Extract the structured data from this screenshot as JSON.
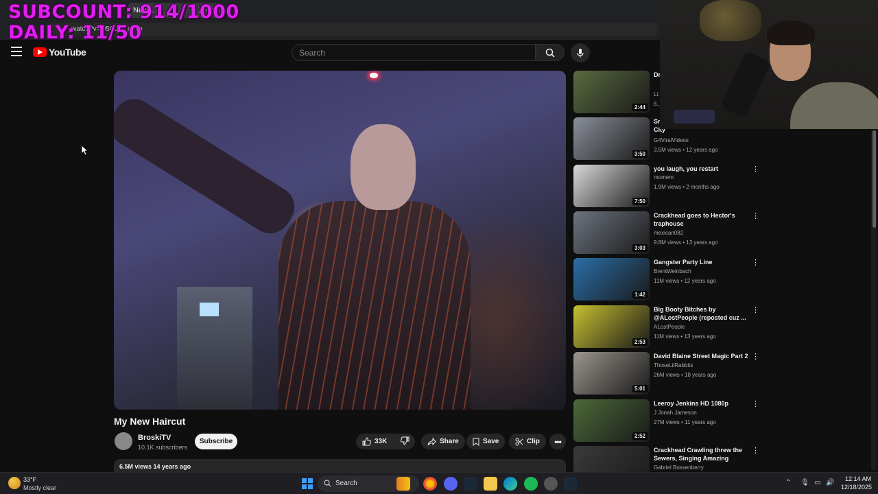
{
  "overlay": {
    "subcount": "SUBCOUNT: 914/1000",
    "daily": "DAILY: 11/50"
  },
  "browser": {
    "tab_title": "New...",
    "url": "watch?v=Q5QJ9i_o5vo"
  },
  "youtube": {
    "logo": "YouTube",
    "search_placeholder": "Search"
  },
  "video": {
    "title": "My New Haircut",
    "channel": "BroskiTV",
    "subscribers": "10.1K subscribers",
    "subscribe_label": "Subscribe",
    "likes": "33K",
    "share_label": "Share",
    "save_label": "Save",
    "clip_label": "Clip",
    "views_age": "6.5M views  14 years ago"
  },
  "related": [
    {
      "title": "Dr... (L...",
      "channel": "Li...",
      "meta": "6...",
      "duration": "2:44",
      "thumb_color": "#5a6b3f"
    },
    {
      "title": "Sr... Trumpet Player in New York City",
      "channel": "G4ViralVideos",
      "meta": "3.5M views • 12 years ago",
      "duration": "3:50",
      "thumb_color": "#8a8f99"
    },
    {
      "title": "you laugh, you restart",
      "channel": "momem",
      "meta": "1.9M views • 2 months ago",
      "duration": "7:50",
      "thumb_color": "#d9d9d9"
    },
    {
      "title": "Crackhead goes to Hector's traphouse",
      "channel": "mexican082",
      "meta": "9.8M views • 13 years ago",
      "duration": "3:03",
      "thumb_color": "#6d7480"
    },
    {
      "title": "Gangster Party Line",
      "channel": "BrentWeinbach",
      "meta": "11M views • 12 years ago",
      "duration": "1:42",
      "thumb_color": "#2a6ea8"
    },
    {
      "title": "Big Booty Bitches by @ALostPeople (reposted cuz ...",
      "channel": "ALostPeople",
      "meta": "11M views • 13 years ago",
      "duration": "2:53",
      "thumb_color": "#c8c030"
    },
    {
      "title": "David Blaine Street Magic Part 2",
      "channel": "ThoseLilRabbits",
      "meta": "26M views • 18 years ago",
      "duration": "5:01",
      "thumb_color": "#9a958d"
    },
    {
      "title": "Leeroy Jenkins HD 1080p",
      "channel": "J Jonah Jameson",
      "meta": "27M views • 11 years ago",
      "duration": "2:52",
      "thumb_color": "#4c6a38"
    },
    {
      "title": "Crackhead Crawling threw the Sewers, Singing Amazing Grac...",
      "channel": "Gabriel Bossenberry",
      "meta": "",
      "duration": "",
      "thumb_color": "#3a3a3a"
    }
  ],
  "taskbar": {
    "weather_temp": "33°F",
    "weather_desc": "Mostly clear",
    "search_label": "Search",
    "time": "12:14 AM",
    "date": "12/18/2025"
  },
  "colors": {
    "accent": "#ff0000",
    "overlay": "#e01ef0",
    "background": "#0f0f0f"
  }
}
